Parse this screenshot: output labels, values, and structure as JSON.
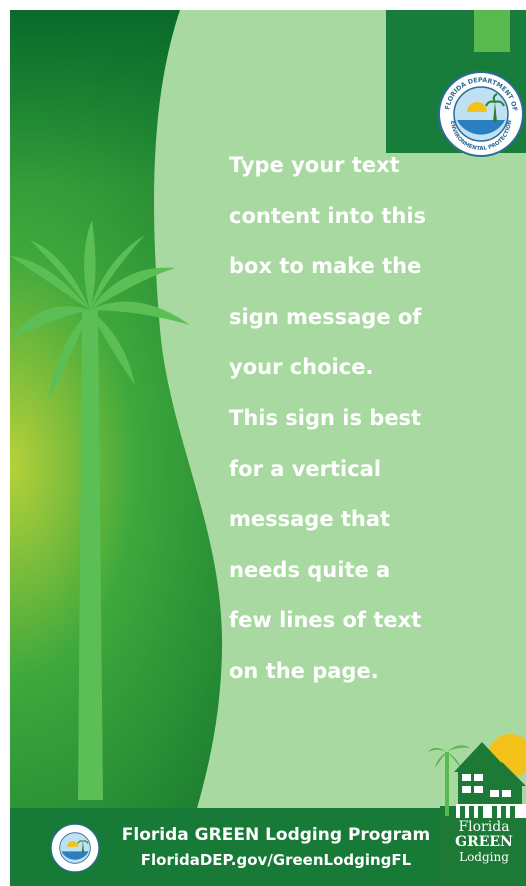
{
  "message": {
    "lines": [
      "Type your text",
      "content into this",
      "box to make the",
      "sign message of",
      "your choice.",
      "This sign is best",
      "for a vertical",
      "message that",
      "needs quite a",
      "few lines of text",
      "on the page."
    ]
  },
  "footer": {
    "program": "Florida GREEN Lodging Program",
    "url": "FloridaDEP.gov/GreenLodgingFL"
  },
  "logo": {
    "line1": "Florida",
    "line2": "GREEN",
    "line3": "Lodging"
  },
  "seal": {
    "text": "FLORIDA DEPARTMENT OF ENVIRONMENTAL PROTECTION"
  },
  "colors": {
    "dark_green": "#0e6f2e",
    "panel_green": "#a8d9a0",
    "palm_green": "#5cbf55",
    "accent_green": "#59b94e",
    "text": "#ffffff"
  }
}
